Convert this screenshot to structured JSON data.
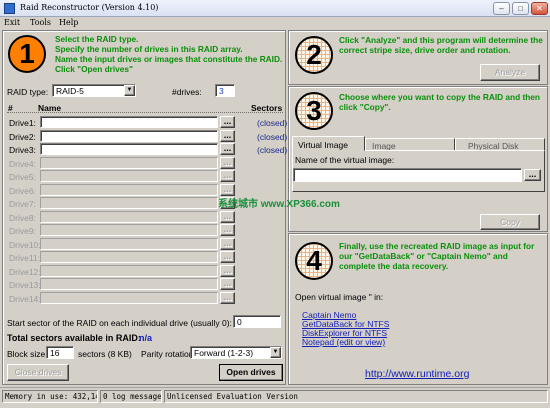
{
  "window": {
    "title": "Raid Reconstructor (Version 4.10)"
  },
  "menu": [
    {
      "label": "Exit"
    },
    {
      "label": "Tools"
    },
    {
      "label": "Help"
    }
  ],
  "step1": {
    "number": "1",
    "instructions": [
      "Select the RAID type.",
      "Specify the number of drives in this RAID array.",
      "Name the input drives or images that constitute the RAID.",
      "Click \"Open drives\""
    ],
    "raid_type_label": "RAID type:",
    "raid_type_value": "RAID-5",
    "drives_label": "#drives:",
    "drives_value": "3",
    "col_hash": "#",
    "col_name": "Name",
    "col_sectors": "Sectors",
    "drives": [
      {
        "label": "Drive1:",
        "status": "(closed)",
        "enabled": true
      },
      {
        "label": "Drive2:",
        "status": "(closed)",
        "enabled": true
      },
      {
        "label": "Drive3:",
        "status": "(closed)",
        "enabled": true
      },
      {
        "label": "Drive4:",
        "enabled": false
      },
      {
        "label": "Drive5:",
        "enabled": false
      },
      {
        "label": "Drive6:",
        "enabled": false
      },
      {
        "label": "Drive7:",
        "enabled": false
      },
      {
        "label": "Drive8:",
        "enabled": false
      },
      {
        "label": "Drive9:",
        "enabled": false
      },
      {
        "label": "Drive10:",
        "enabled": false
      },
      {
        "label": "Drive11:",
        "enabled": false
      },
      {
        "label": "Drive12:",
        "enabled": false
      },
      {
        "label": "Drive13:",
        "enabled": false
      },
      {
        "label": "Drive14:",
        "enabled": false
      }
    ],
    "browse_label": "...",
    "start_sector_label": "Start sector of the RAID on each individual drive (usually 0):",
    "start_sector_value": "0",
    "total_label": "Total sectors available in RAID:",
    "total_value": "n/a",
    "block_size_label": "Block size:",
    "block_size_value": "16",
    "block_size_unit": "sectors (8 KB)",
    "parity_label": "Parity rotation:",
    "parity_value": "Forward (1-2-3)",
    "close_drives": "Close drives",
    "open_drives": "Open drives"
  },
  "step2": {
    "number": "2",
    "text": "Click \"Analyze\" and this program will determine the correct stripe size, drive order and rotation.",
    "analyze": "Analyze"
  },
  "step3": {
    "number": "3",
    "text": "Choose where you want to copy the RAID and then click \"Copy\".",
    "tabs": [
      "Virtual Image",
      "Image",
      "Physical Disk"
    ],
    "vi_label": "Name of the virtual image:",
    "browse": "...",
    "copy": "Copy"
  },
  "step4": {
    "number": "4",
    "text": "Finally, use the recreated RAID image as input for our \"GetDataBack\" or \"Captain Nemo\" and complete the data recovery.",
    "open_label": "Open virtual image \" in:",
    "links": [
      "Captain Nemo",
      "GetDataBack for NTFS",
      "DiskExplorer for NTFS",
      "Notepad (edit or view)"
    ],
    "url": "http://www.runtime.org"
  },
  "watermark": "系统城市 www.XP366.com",
  "status": {
    "memory": "Memory in use: 432,144",
    "log": "0 log messages",
    "license": "Unlicensed Evaluation Version"
  },
  "colors": {
    "accent_green": "#0a8f0a",
    "step1_circle": "#ff7f00",
    "link_blue": "#1520b8"
  }
}
